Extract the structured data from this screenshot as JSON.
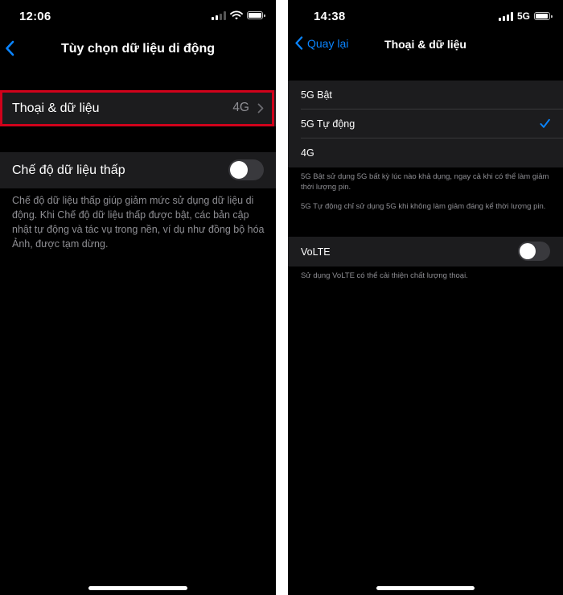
{
  "left": {
    "status": {
      "time": "12:06"
    },
    "nav": {
      "title": "Tùy chọn dữ liệu di động"
    },
    "voice_data_row": {
      "label": "Thoại & dữ liệu",
      "value": "4G"
    },
    "low_data_row": {
      "label": "Chế độ dữ liệu thấp",
      "enabled": false
    },
    "low_data_footer": "Chế độ dữ liệu thấp giúp giảm mức sử dụng dữ liệu di động. Khi Chế độ dữ liệu thấp được bật, các bản cập nhật tự động và tác vụ trong nền, ví dụ như đồng bộ hóa Ảnh, được tạm dừng.",
    "highlight_color": "#d0021b"
  },
  "right": {
    "status": {
      "time": "14:38",
      "network": "5G"
    },
    "nav": {
      "back_label": "Quay lại",
      "title": "Thoại & dữ liệu"
    },
    "options": [
      {
        "label": "5G Bật",
        "selected": false
      },
      {
        "label": "5G Tự động",
        "selected": true
      },
      {
        "label": "4G",
        "selected": false
      }
    ],
    "footer_1": "5G Bật sử dụng 5G bất kỳ lúc nào khả dụng, ngay cả khi có thể làm giảm thời lượng pin.",
    "footer_2": "5G Tự động chỉ sử dụng 5G khi không làm giảm đáng kể thời lượng pin.",
    "volte_row": {
      "label": "VoLTE",
      "enabled": false
    },
    "volte_footer": "Sử dụng VoLTE có thể cải thiện chất lượng thoại."
  },
  "colors": {
    "accent": "#0a84ff",
    "background": "#000000",
    "cell": "#1c1c1e"
  },
  "icons": [
    "back-chevron-icon",
    "chevron-right-icon",
    "checkmark-icon",
    "cellular-signal-icon",
    "wifi-icon",
    "battery-icon"
  ]
}
